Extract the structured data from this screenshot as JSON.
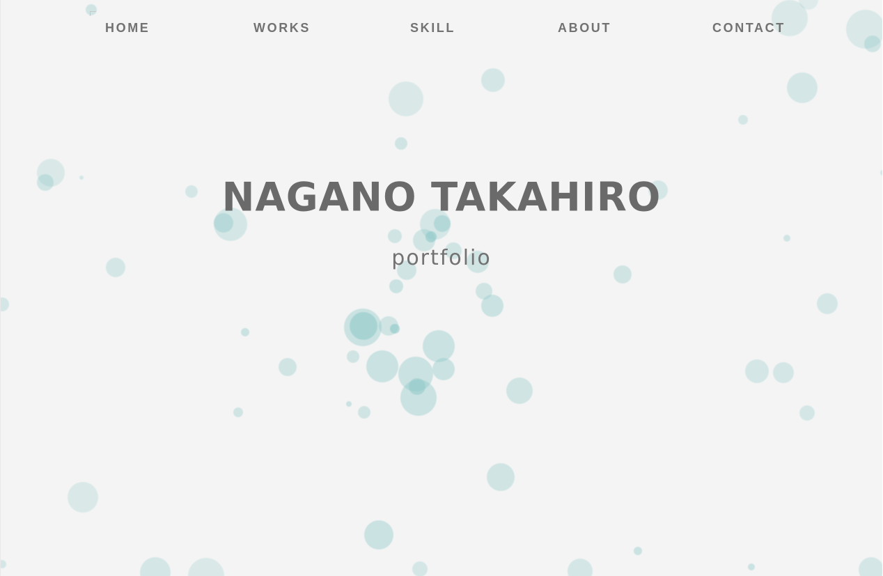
{
  "nav": {
    "home": "HOME",
    "works": "WORKS",
    "skill": "SKILL",
    "about": "ABOUT",
    "contact": "CONTACT"
  },
  "hero": {
    "title": "NAGANO TAKAHIRO",
    "subtitle": "portfolio"
  },
  "colors": {
    "background": "#f4f4f4",
    "text": "#727272",
    "bubble": "#8ec8c8"
  }
}
